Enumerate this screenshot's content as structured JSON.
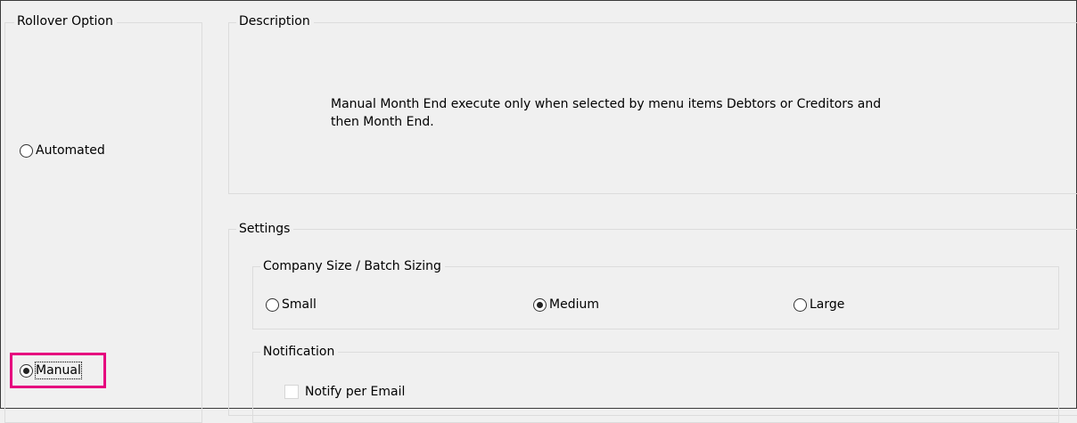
{
  "rollover": {
    "legend": "Rollover Option",
    "options": {
      "automated": {
        "label": "Automated",
        "checked": false
      },
      "manual": {
        "label": "Manual",
        "checked": true
      }
    }
  },
  "description": {
    "legend": "Description",
    "text_line1": "Manual Month End execute only when selected by menu items Debtors or Creditors and",
    "text_line2": "then Month End."
  },
  "settings": {
    "legend": "Settings",
    "company_size": {
      "legend": "Company Size / Batch Sizing",
      "options": {
        "small": {
          "label": "Small",
          "checked": false
        },
        "medium": {
          "label": "Medium",
          "checked": true
        },
        "large": {
          "label": "Large",
          "checked": false
        }
      }
    },
    "notification": {
      "legend": "Notification",
      "notify_email": {
        "label": "Notify per Email",
        "checked": false
      }
    }
  },
  "colors": {
    "highlight": "#e6007e",
    "background": "#f0f0f0",
    "group_border": "#dcdcdc"
  }
}
